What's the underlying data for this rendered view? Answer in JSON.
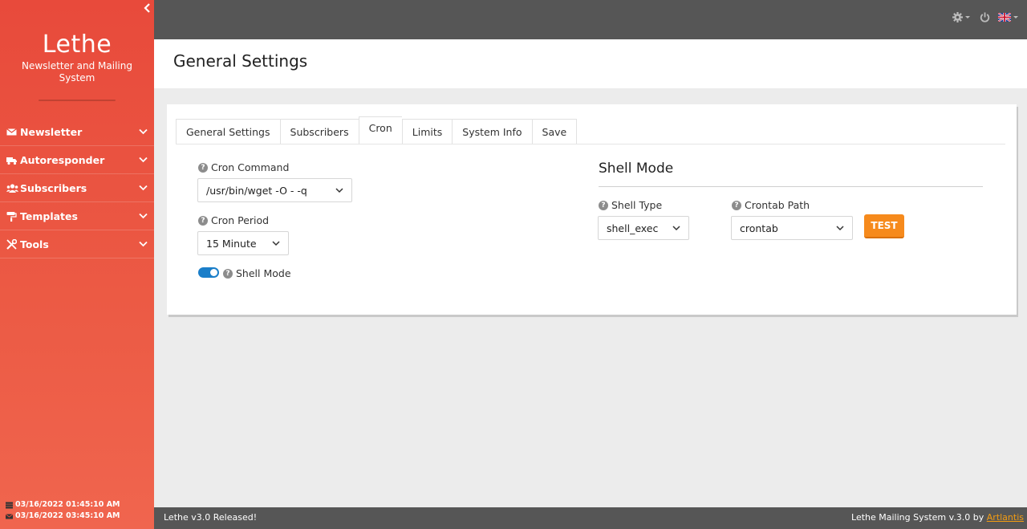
{
  "sidebar": {
    "brand_title": "Lethe",
    "brand_subtitle": "Newsletter and Mailing System",
    "items": [
      {
        "label": "Newsletter",
        "icon": "envelope-icon"
      },
      {
        "label": "Autoresponder",
        "icon": "truck-icon"
      },
      {
        "label": "Subscribers",
        "icon": "users-icon"
      },
      {
        "label": "Templates",
        "icon": "paint-roller-icon"
      },
      {
        "label": "Tools",
        "icon": "tools-icon"
      }
    ],
    "footer": {
      "server_time": "03/16/2022 01:45:10 AM",
      "local_time": "03/16/2022 03:45:10 AM"
    }
  },
  "topbar": {
    "icons": [
      "gear-icon",
      "power-icon",
      "uk-flag-icon"
    ]
  },
  "page": {
    "title": "General Settings"
  },
  "tabs": [
    {
      "label": "General Settings",
      "active": false
    },
    {
      "label": "Subscribers",
      "active": false
    },
    {
      "label": "Cron",
      "active": true
    },
    {
      "label": "Limits",
      "active": false
    },
    {
      "label": "System Info",
      "active": false
    },
    {
      "label": "Save",
      "active": false
    }
  ],
  "cron": {
    "command_label": "Cron Command",
    "command_value": "/usr/bin/wget -O - -q",
    "period_label": "Cron Period",
    "period_value": "15 Minute",
    "shell_mode_label": "Shell Mode",
    "shell_mode_enabled": true
  },
  "shell": {
    "section_title": "Shell Mode",
    "type_label": "Shell Type",
    "type_value": "shell_exec",
    "crontab_label": "Crontab Path",
    "crontab_value": "crontab",
    "test_button": "TEST"
  },
  "footer": {
    "left_text": "Lethe v3.0 Released!",
    "right_text": "Lethe Mailing System v.3.0 by ",
    "author_link": "Artlantis"
  },
  "colors": {
    "sidebar": "#e84a3b",
    "topbar": "#565656",
    "accent_orange": "#f68a1c",
    "toggle_blue": "#1a7ec9"
  }
}
